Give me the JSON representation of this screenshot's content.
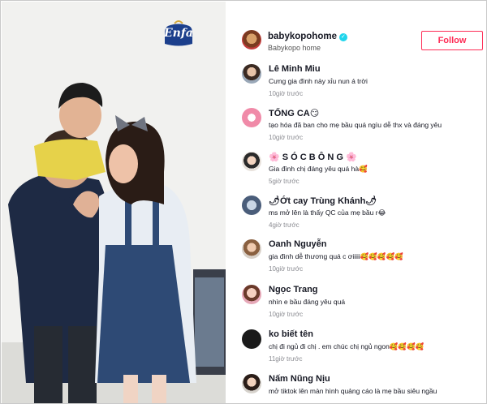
{
  "video": {
    "brand_logo_text": "Enfa"
  },
  "post": {
    "username": "babykopohome",
    "verified_icon": "verified-check-icon",
    "display_name": "Babykopo home",
    "follow_label": "Follow",
    "accent_color": "#fe2c55"
  },
  "comments": [
    {
      "user": "Lê Minh Miu",
      "text": "Cưng gia đình này xỉu nun á trời",
      "time": "10giờ trước"
    },
    {
      "user": "TỐNG CA😏",
      "text": "tạo hóa đã ban cho mẹ bầu quá ngìu dễ thx và đáng yêu",
      "time": "10giờ trước"
    },
    {
      "user": "🌸 S Ó C B Ô N G 🌸",
      "text": "Gia đình chị đáng yêu quá hà🥰",
      "time": "5giờ trước"
    },
    {
      "user": "🌶Ớt cay Trùng Khánh🌶",
      "text": "ms mở lên là thấy QC của mẹ bầu r😂",
      "time": "4giờ trước"
    },
    {
      "user": "Oanh Nguyễn",
      "text": "gia đình dễ thương quá c ơiiiii🥰🥰🥰🥰🥰",
      "time": "10giờ trước"
    },
    {
      "user": "Ngọc Trang",
      "text": "nhìn e bầu đáng yêu quá",
      "time": "10giờ trước"
    },
    {
      "user": "ko biết tên",
      "text": "chị đi ngủ đi chị . em chúc chị ngủ ngon🥰🥰🥰🥰",
      "time": "11giờ trước"
    },
    {
      "user": "Nấm Nũng Nịu",
      "text": "mở tiktok lên màn hình quảng cáo là mẹ bầu siêu ngầu",
      "time": ""
    }
  ]
}
